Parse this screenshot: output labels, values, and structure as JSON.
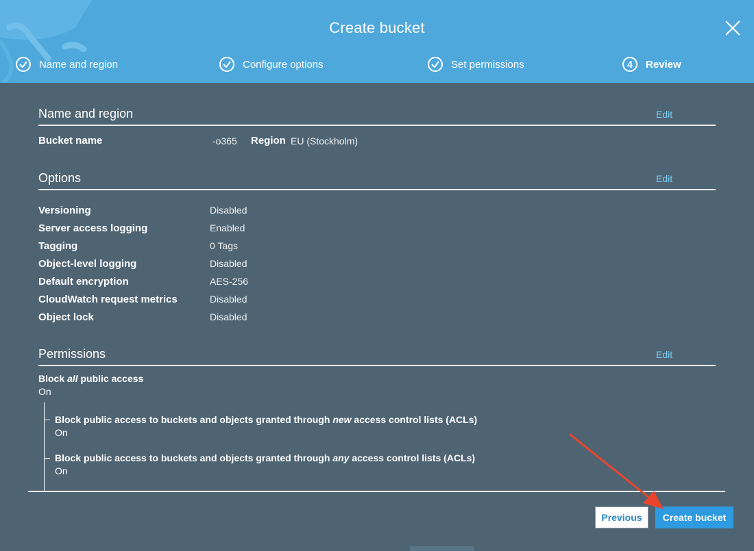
{
  "dialog": {
    "title": "Create bucket"
  },
  "steps": [
    {
      "label": "Name and region",
      "state": "done"
    },
    {
      "label": "Configure options",
      "state": "done"
    },
    {
      "label": "Set permissions",
      "state": "done"
    },
    {
      "label": "Review",
      "number": "4",
      "state": "active"
    }
  ],
  "name_region": {
    "title": "Name and region",
    "edit": "Edit",
    "bucket_label": "Bucket name",
    "bucket_value": "-o365",
    "region_label": "Region",
    "region_value": "EU (Stockholm)"
  },
  "options": {
    "title": "Options",
    "edit": "Edit",
    "rows": [
      {
        "label": "Versioning",
        "value": "Disabled"
      },
      {
        "label": "Server access logging",
        "value": "Enabled"
      },
      {
        "label": "Tagging",
        "value": "0 Tags"
      },
      {
        "label": "Object-level logging",
        "value": "Disabled"
      },
      {
        "label": "Default encryption",
        "value": "AES-256"
      },
      {
        "label": "CloudWatch request metrics",
        "value": "Disabled"
      },
      {
        "label": "Object lock",
        "value": "Disabled"
      }
    ]
  },
  "permissions": {
    "title": "Permissions",
    "edit": "Edit",
    "block_all": {
      "pre": "Block ",
      "em": "all",
      "post": " public access",
      "value": "On"
    },
    "new_acl": {
      "pre": "Block public access to buckets and objects granted through ",
      "em": "new",
      "post": " access control lists (ACLs)",
      "value": "On"
    },
    "any_acl": {
      "pre": "Block public access to buckets and objects granted through ",
      "em": "any",
      "post": " access control lists (ACLs)",
      "value": "On"
    }
  },
  "footer": {
    "previous_label": "Previous",
    "create_label": "Create bucket"
  },
  "colors": {
    "header": "#4ea8dc",
    "body": "#4f6473",
    "link": "#7ad0f5",
    "primary_button": "#2e9ae0",
    "annotation_arrow": "#e8452c"
  }
}
